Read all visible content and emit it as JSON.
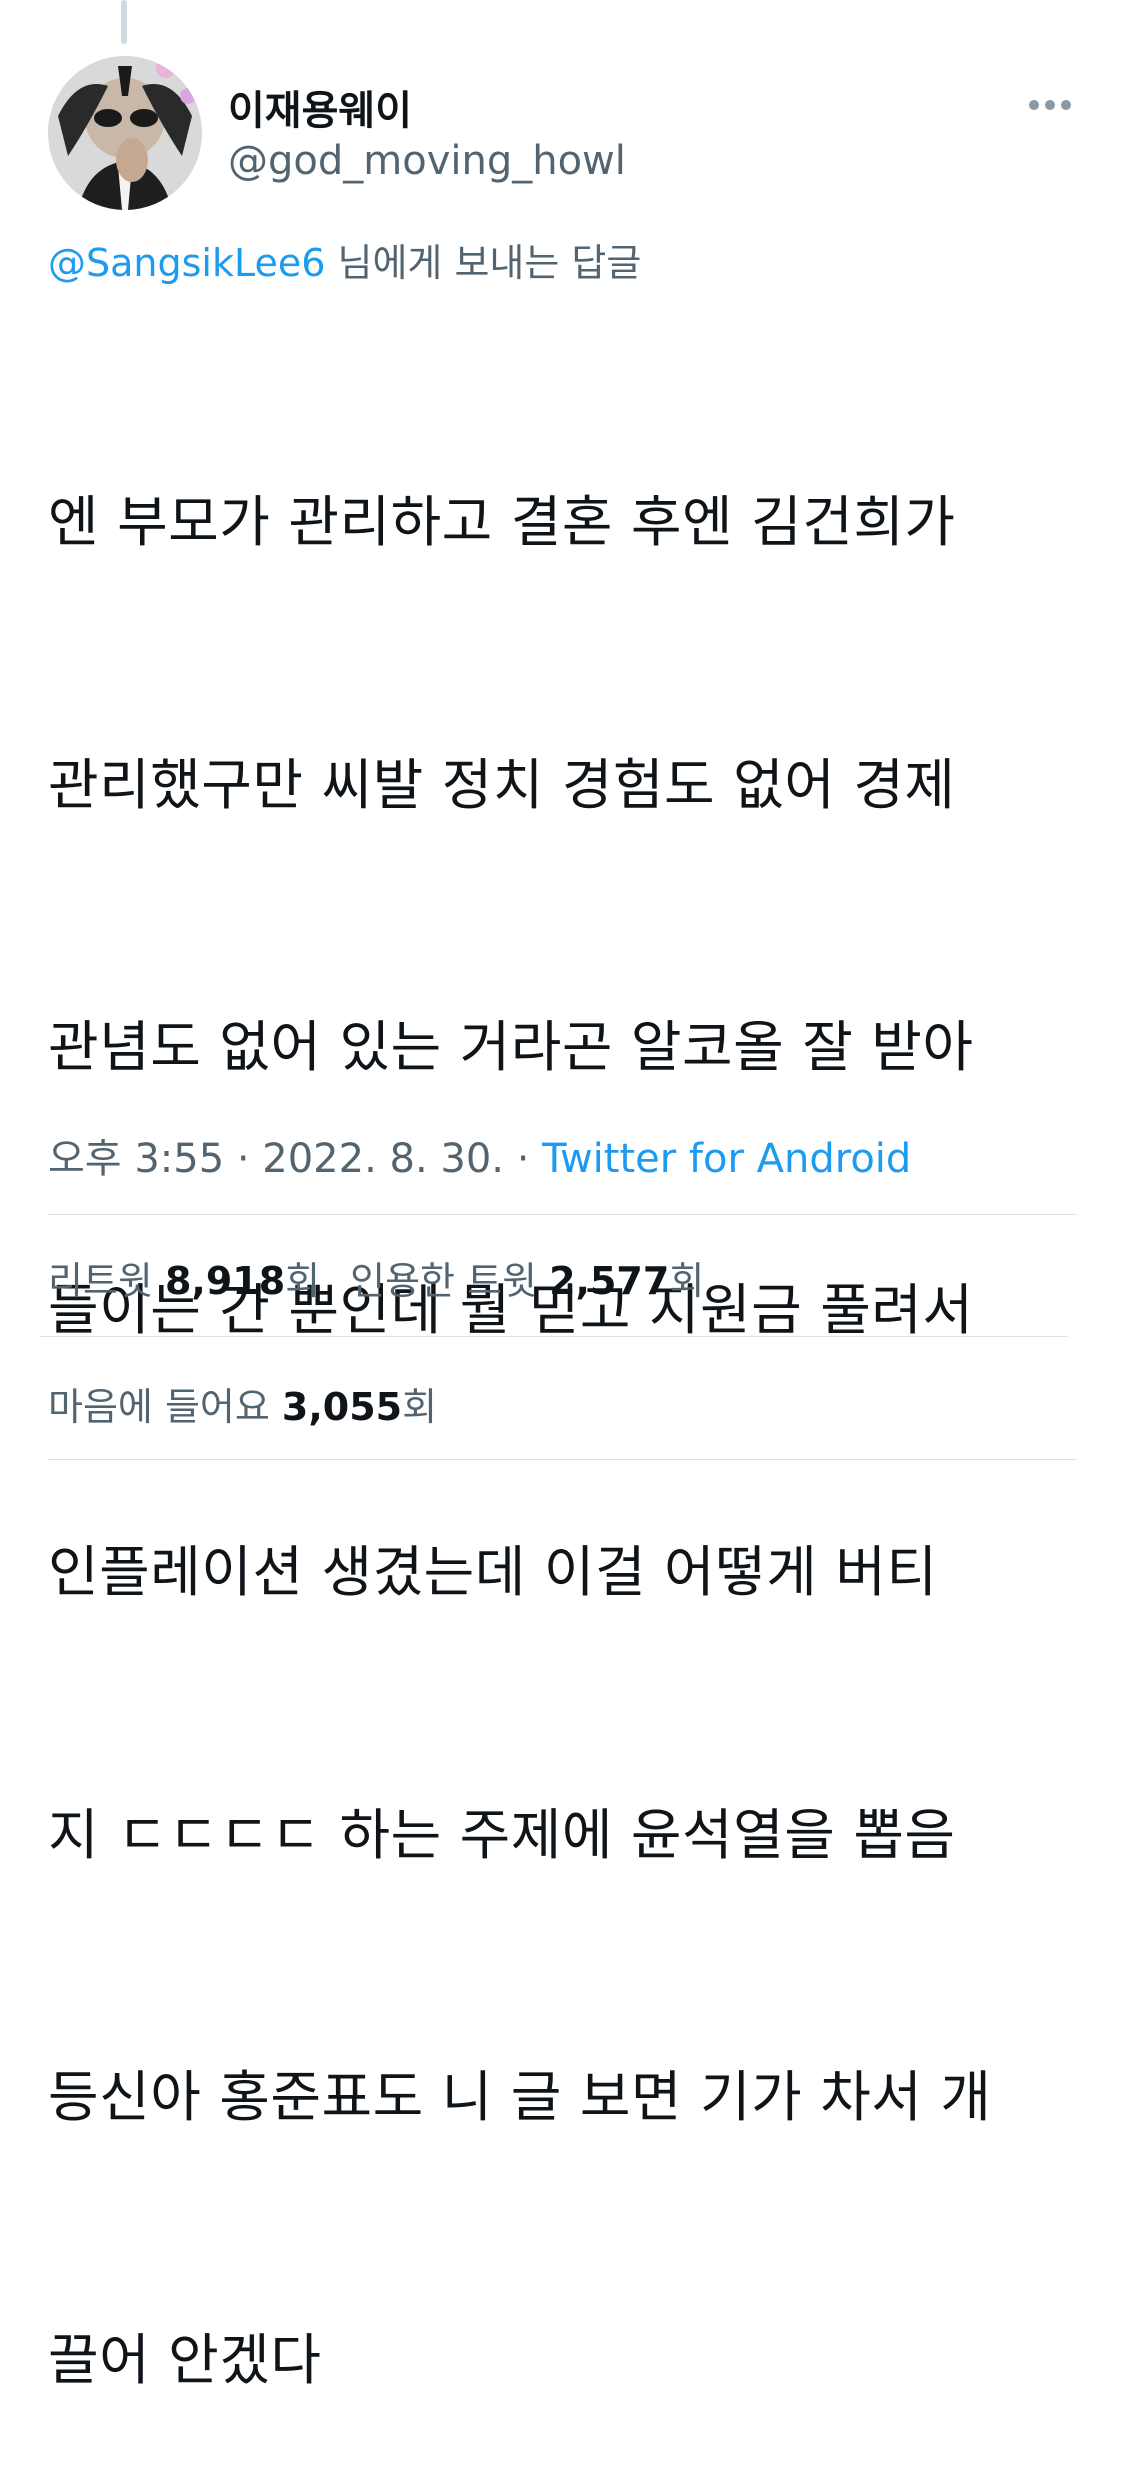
{
  "tweet": {
    "author": {
      "display_name": "이재용웨이",
      "handle": "@god_moving_howl",
      "avatar_icon": "profile-photo"
    },
    "more_icon": "more-horizontal-icon",
    "reply_to": {
      "mention": "@SangsikLee6",
      "suffix": " 님에게 보내는 답글"
    },
    "text_lines": [
      "엔 부모가 관리하고 결혼 후엔 김건희가",
      "관리했구만 씨발 정치 경험도 없어 경제",
      "관념도 없어 있는 거라곤 알코올 잘 받아",
      "들이는 간 뿐인데 뭘 믿고 지원금 풀려서",
      "인플레이션 생겼는데 이걸 어떻게 버티",
      "지 ㄷㄷㄷㄷ 하는 주제에 윤석열을 뽑음",
      "등신아 홍준표도 니 글 보면 기가 차서 개",
      "끌어 안겠다"
    ],
    "timestamp": "오후 3:55 · 2022. 8. 30. · ",
    "source": "Twitter for Android",
    "stats": {
      "retweets_label": "리트윗 ",
      "retweets_count": "8,918",
      "retweets_unit": "회",
      "quotes_label": "인용한 트윗 ",
      "quotes_count": "2,577",
      "quotes_unit": "회",
      "likes_label": "마음에 들어요 ",
      "likes_count": "3,055",
      "likes_unit": "회"
    }
  },
  "colors": {
    "text": "#0f1419",
    "secondary": "#536471",
    "link": "#1d9bf0",
    "divider": "#dfe3e6"
  }
}
